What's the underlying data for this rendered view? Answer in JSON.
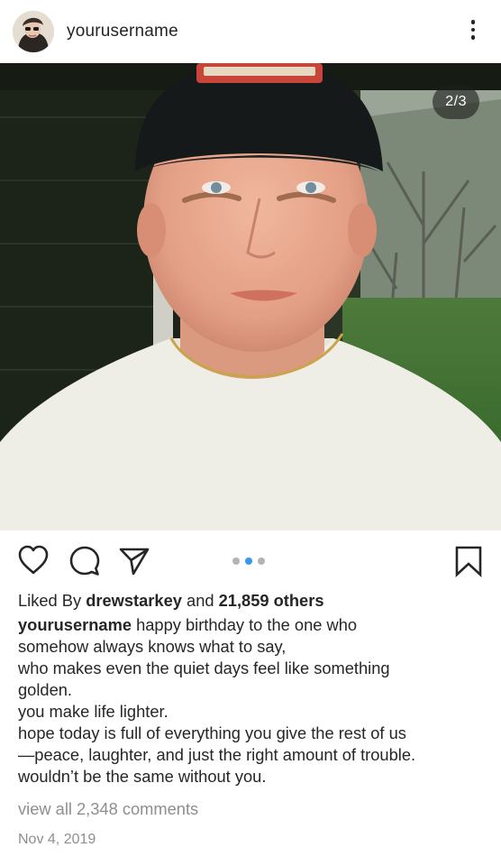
{
  "header": {
    "username": "yourusername",
    "more_icon": "more-vertical-icon"
  },
  "photo": {
    "counter": "2/3"
  },
  "actions": {
    "icons": [
      "heart-icon",
      "comment-icon",
      "share-icon",
      "bookmark-icon"
    ],
    "carousel": {
      "total": 3,
      "active_index": 1
    },
    "accent_color": "#3897f0"
  },
  "likes": {
    "prefix": "Liked By",
    "user": "drewstarkey",
    "middle": "and",
    "others": "21,859 others"
  },
  "caption": {
    "username": "yourusername",
    "lines": [
      "happy birthday to the one who",
      "somehow always knows what to say,",
      "who makes even the quiet days feel like something",
      "golden.",
      "you make life lighter.",
      "hope today is full of everything you give the rest of us",
      "—peace, laughter, and just the right amount of trouble.",
      "wouldn’t be the same without you."
    ]
  },
  "comments": {
    "view_all": "view all 2,348 comments"
  },
  "post_date": "Nov 4, 2019"
}
